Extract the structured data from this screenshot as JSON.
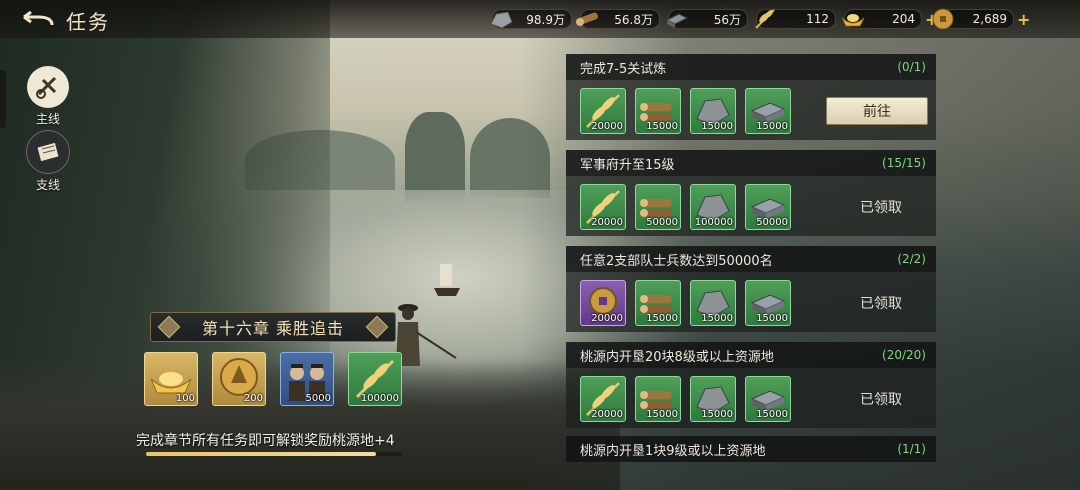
{
  "header": {
    "title": "任务",
    "resources": [
      {
        "icon": "ore-icon",
        "value": "98.9万",
        "plus": false
      },
      {
        "icon": "wood-icon",
        "value": "56.8万",
        "plus": false
      },
      {
        "icon": "iron-icon",
        "value": "56万",
        "plus": false
      },
      {
        "icon": "grain-icon",
        "value": "112",
        "plus": false
      },
      {
        "icon": "gold-ingot-icon",
        "value": "204",
        "plus": true
      },
      {
        "icon": "copper-coin-icon",
        "value": "2,689",
        "plus": true
      }
    ]
  },
  "sidenav": {
    "items": [
      {
        "label": "主线",
        "icon": "main-quest-icon",
        "selected": true
      },
      {
        "label": "支线",
        "icon": "scroll-icon",
        "selected": false
      }
    ]
  },
  "chapter": {
    "title": "第十六章 乘胜追击",
    "rewards": [
      {
        "icon": "gold-ingot-icon",
        "count": "100",
        "rarity": "gold"
      },
      {
        "icon": "copper-coin-icon",
        "count": "200",
        "rarity": "gold"
      },
      {
        "icon": "soldiers-icon",
        "count": "5000",
        "rarity": "blue"
      },
      {
        "icon": "grain-icon",
        "count": "100000",
        "rarity": "green"
      }
    ],
    "unlock_text": "完成章节所有任务即可解锁奖励桃源地+4",
    "progress": 0.9
  },
  "tasks": [
    {
      "title": "完成7-5关试炼",
      "progress": "(0/1)",
      "rewards": [
        {
          "icon": "grain-icon",
          "count": "20000",
          "rarity": "green"
        },
        {
          "icon": "wood-icon",
          "count": "15000",
          "rarity": "green"
        },
        {
          "icon": "stone-icon",
          "count": "15000",
          "rarity": "green"
        },
        {
          "icon": "iron-icon",
          "count": "15000",
          "rarity": "green"
        }
      ],
      "action": "前往",
      "done": false
    },
    {
      "title": "军事府升至15级",
      "progress": "(15/15)",
      "rewards": [
        {
          "icon": "grain-icon",
          "count": "20000",
          "rarity": "green"
        },
        {
          "icon": "wood-icon",
          "count": "50000",
          "rarity": "green"
        },
        {
          "icon": "stone-icon",
          "count": "100000",
          "rarity": "green"
        },
        {
          "icon": "iron-icon",
          "count": "50000",
          "rarity": "green"
        }
      ],
      "action": "已领取",
      "done": true
    },
    {
      "title": "任意2支部队士兵数达到50000名",
      "progress": "(2/2)",
      "rewards": [
        {
          "icon": "copper-coin-icon",
          "count": "20000",
          "rarity": "purple"
        },
        {
          "icon": "wood-icon",
          "count": "15000",
          "rarity": "green"
        },
        {
          "icon": "stone-icon",
          "count": "15000",
          "rarity": "green"
        },
        {
          "icon": "iron-icon",
          "count": "15000",
          "rarity": "green"
        }
      ],
      "action": "已领取",
      "done": true
    },
    {
      "title": "桃源内开垦20块8级或以上资源地",
      "progress": "(20/20)",
      "rewards": [
        {
          "icon": "grain-icon",
          "count": "20000",
          "rarity": "green"
        },
        {
          "icon": "wood-icon",
          "count": "15000",
          "rarity": "green"
        },
        {
          "icon": "stone-icon",
          "count": "15000",
          "rarity": "green"
        },
        {
          "icon": "iron-icon",
          "count": "15000",
          "rarity": "green"
        }
      ],
      "action": "已领取",
      "done": true
    },
    {
      "title": "桃源内开垦1块9级或以上资源地",
      "progress": "(1/1)",
      "rewards": [],
      "action": "",
      "done": true
    }
  ]
}
